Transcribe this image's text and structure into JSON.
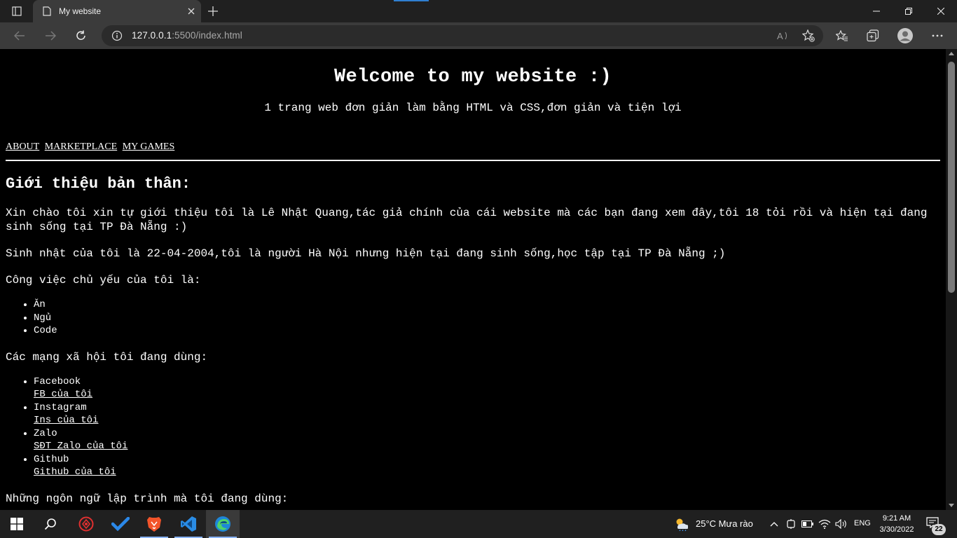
{
  "browser": {
    "tab_title": "My website",
    "url_host": "127.0.0.1",
    "url_path": ":5500/index.html"
  },
  "page": {
    "heading": "Welcome to my website :)",
    "subtitle": "1 trang web đơn giản làm bằng HTML và CSS,đơn giản và tiện lợi",
    "nav": [
      "ABOUT",
      "MARKETPLACE",
      "MY GAMES"
    ],
    "about_heading": "Giới thiệu bản thân:",
    "intro": "Xin chào tôi xin tự giới thiệu tôi là Lê Nhật Quang,tác giả chính của cái website mà các bạn đang xem đây,tôi 18 tỏi rồi và hiện tại đang sinh sống tại TP Đà Nẵng :)",
    "birthday": "Sinh nhật của tôi là 22-04-2004,tôi là người Hà Nội nhưng hiện tại đang sinh sống,học tập tại TP Đà Nẵng ;)",
    "work_intro": "Công việc chủ yếu của tôi là:",
    "work_items": [
      "Ăn",
      "Ngủ",
      "Code"
    ],
    "social_intro": "Các mạng xã hội tôi đang dùng:",
    "social": [
      {
        "name": "Facebook",
        "link": "FB của tôi"
      },
      {
        "name": "Instagram",
        "link": "Ins của tôi"
      },
      {
        "name": "Zalo",
        "link": "SĐT Zalo của tôi"
      },
      {
        "name": "Github",
        "link": "Github của tôi"
      }
    ],
    "languages_intro": "Những ngôn ngữ lập trình mà tôi đang dùng:"
  },
  "taskbar": {
    "weather": "25°C  Mưa rào",
    "lang": "ENG",
    "time": "9:21 AM",
    "date": "3/30/2022",
    "notifications": "22"
  },
  "colors": {
    "page_bg": "#000000",
    "chrome_bg": "#202020",
    "toolbar_bg": "#3b3b3b",
    "accent": "#2f7fd1"
  }
}
